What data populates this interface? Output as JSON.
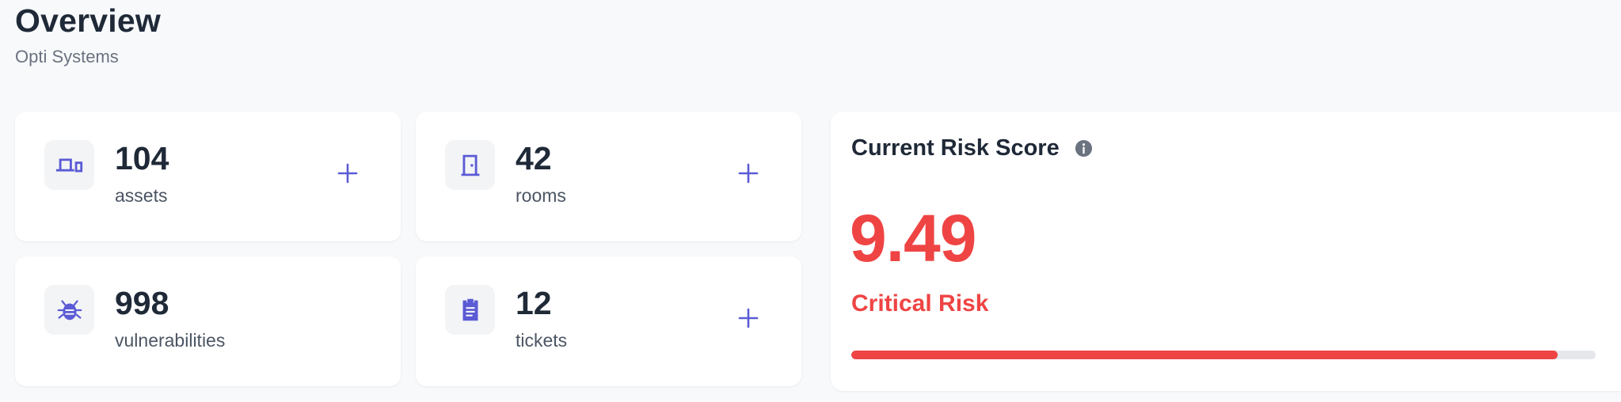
{
  "header": {
    "title": "Overview",
    "subtitle": "Opti Systems"
  },
  "stats": [
    {
      "value": "104",
      "label": "assets",
      "icon": "devices-icon",
      "add_label": "+"
    },
    {
      "value": "42",
      "label": "rooms",
      "icon": "door-icon",
      "add_label": "+"
    },
    {
      "value": "998",
      "label": "vulnerabilities",
      "icon": "bug-icon",
      "add_label": "+"
    },
    {
      "value": "12",
      "label": "tickets",
      "icon": "clipboard-icon",
      "add_label": "+"
    }
  ],
  "risk": {
    "title": "Current Risk Score",
    "score": "9.49",
    "level": "Critical Risk",
    "progress_fraction": 0.949,
    "info_icon": "info-icon"
  },
  "colors": {
    "accent": "#5b5bd6",
    "danger": "#ef4444",
    "text_primary": "#1f2937",
    "text_secondary": "#6b7280",
    "background": "#f7f9fb",
    "icon_background": "#f3f4f6",
    "track": "#e5e7eb"
  }
}
